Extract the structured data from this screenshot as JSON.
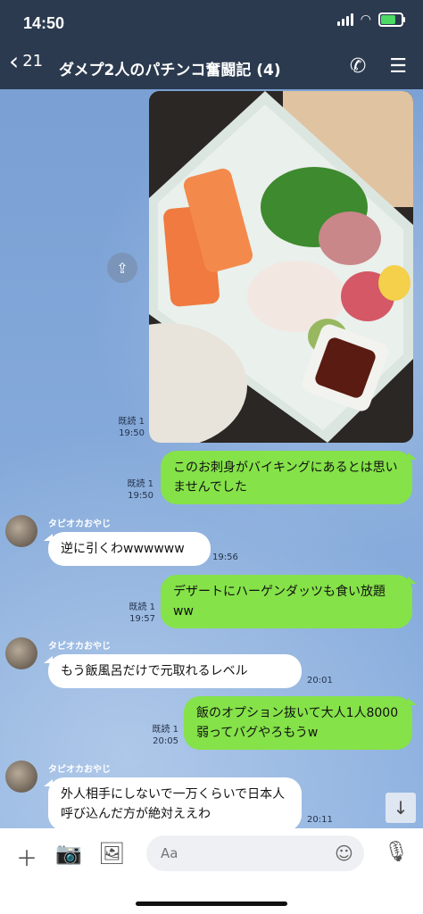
{
  "status": {
    "time": "14:50"
  },
  "nav": {
    "back_count": "21",
    "title": "ダメプ2人のパチンコ奮闘記 (4)"
  },
  "photo": {
    "read": "既読 1",
    "time": "19:50"
  },
  "messages": [
    {
      "side": "right",
      "read": "既読 1",
      "time": "19:50",
      "text": "このお刺身がバイキングにあるとは思いませんでした"
    },
    {
      "side": "left",
      "sender": "タピオカおやじ",
      "time": "19:56",
      "text": "逆に引くわwwwwww"
    },
    {
      "side": "right",
      "read": "既読 1",
      "time": "19:57",
      "text": "デザートにハーゲンダッツも食い放題ww"
    },
    {
      "side": "left",
      "sender": "タピオカおやじ",
      "time": "20:01",
      "text": "もう飯風呂だけで元取れるレベル"
    },
    {
      "side": "right",
      "read": "既読 1",
      "time": "20:05",
      "text": "飯のオプション抜いて大人1人8000弱ってバグやろもうw"
    },
    {
      "side": "left",
      "sender": "タピオカおやじ",
      "time": "20:11",
      "text": "外人相手にしないで一万くらいで日本人呼び込んだ方が絶対ええわ"
    }
  ],
  "input": {
    "placeholder": "Aa"
  },
  "colors": {
    "header": "#2b3a4f",
    "bubble_green": "#85e249",
    "bubble_white": "#ffffff"
  }
}
